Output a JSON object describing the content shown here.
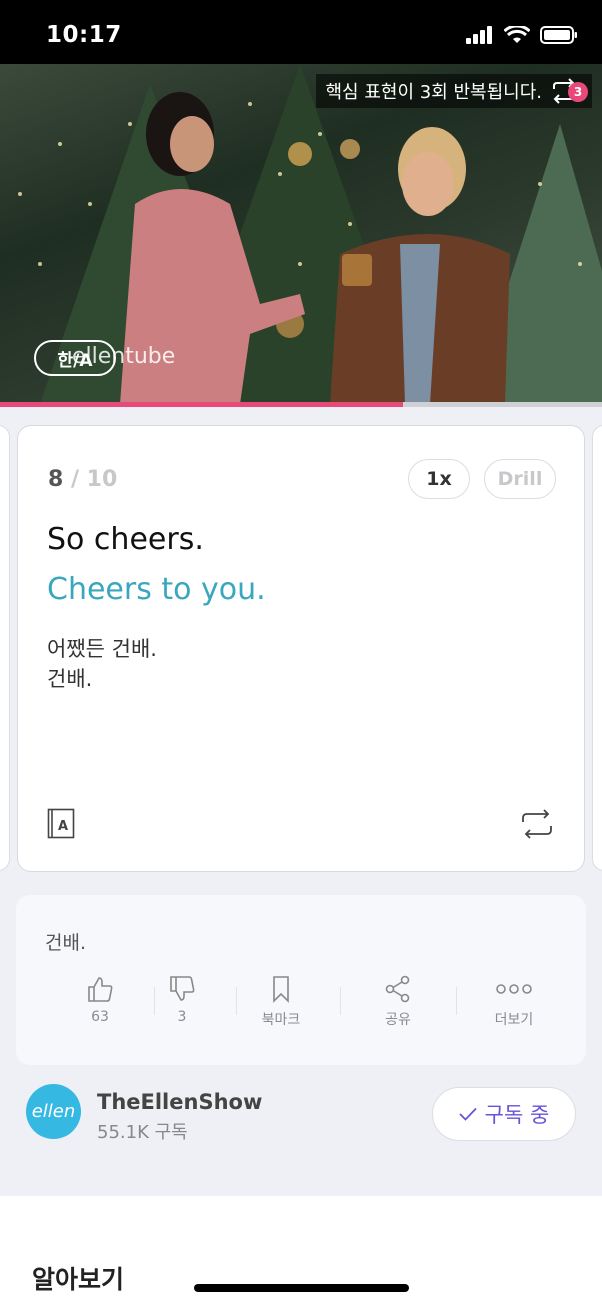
{
  "status_bar": {
    "time": "10:17"
  },
  "video": {
    "banner_text": "핵심 표현이 3회 반복됩니다.",
    "repeat_count": "3",
    "lang_toggle": "한/A",
    "watermark": "ellentube",
    "progress": 0.67
  },
  "card": {
    "current": "8",
    "separator": " / ",
    "total": "10",
    "speed_label": "1x",
    "drill_label": "Drill",
    "sentence_main": "So cheers.",
    "sentence_alt": "Cheers to you.",
    "translation_1": "어쨌든 건배.",
    "translation_2": "건배.",
    "dict_icon_letter": "A"
  },
  "info": {
    "text": "건배.",
    "actions": [
      {
        "icon": "thumbs-up-icon",
        "label": "63"
      },
      {
        "icon": "thumbs-down-icon",
        "label": "3"
      },
      {
        "icon": "bookmark-icon",
        "label": "북마크"
      },
      {
        "icon": "share-icon",
        "label": "공유"
      },
      {
        "icon": "more-icon",
        "label": "더보기"
      }
    ]
  },
  "channel": {
    "avatar_text": "ellen",
    "name": "TheEllenShow",
    "subscribers": "55.1K 구독",
    "subscribe_label": "구독 중"
  },
  "section": {
    "title": "알아보기"
  },
  "colors": {
    "accent_pink": "#e8497b",
    "accent_teal": "#3aa7bf",
    "accent_purple": "#6a52d6",
    "avatar_blue": "#35b8e2"
  }
}
